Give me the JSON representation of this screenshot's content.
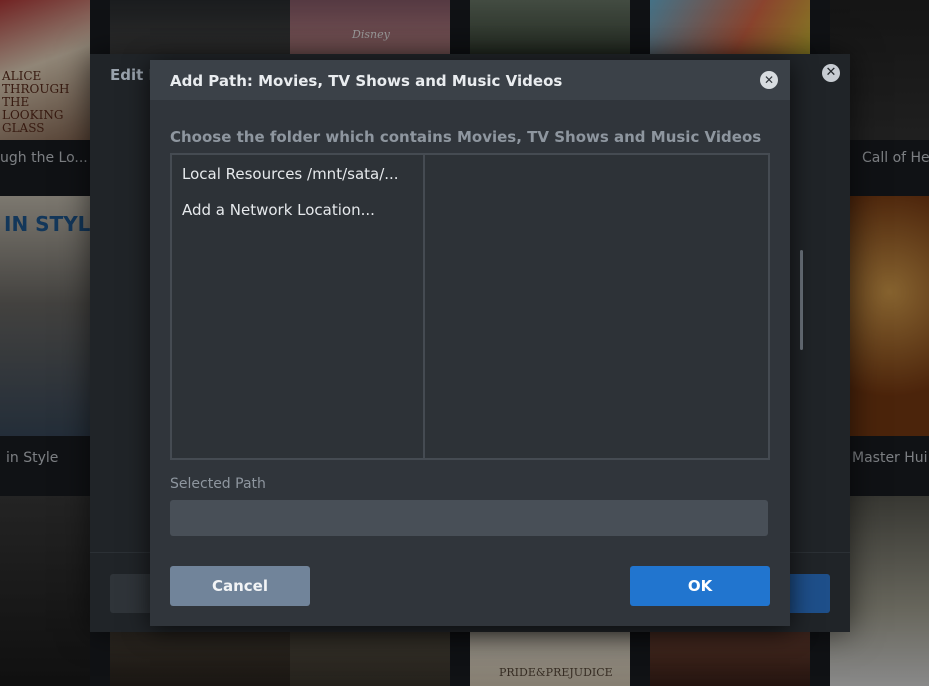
{
  "background": {
    "captions": {
      "left_top": "ugh the Lo...",
      "right_top": "Call of He",
      "left_mid": "in Style",
      "right_mid": "Master Hui"
    },
    "poster_texts": {
      "alice": "ALICE THROUGH THE LOOKING GLASS",
      "disney": "Disney",
      "style": "IN STYLE",
      "pride": "PRIDE&PREJUDICE"
    }
  },
  "edit_dialog": {
    "title": "Edit L"
  },
  "modal": {
    "title": "Add Path: Movies, TV Shows and Music Videos",
    "subtitle": "Choose the folder which contains Movies, TV Shows and Music Videos",
    "browser_items": [
      {
        "label": "Local Resources /mnt/sata/..."
      },
      {
        "label": "Add a Network Location..."
      }
    ],
    "selected_path_label": "Selected Path",
    "selected_path_value": "",
    "cancel_label": "Cancel",
    "ok_label": "OK"
  },
  "colors": {
    "accent": "#2175cf",
    "cancel": "#71849a",
    "modal_bg": "#30353b",
    "header_bg": "#3b4148"
  }
}
